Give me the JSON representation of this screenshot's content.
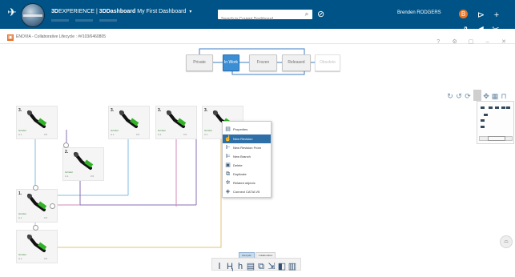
{
  "topbar": {
    "brand_bold": "3D",
    "brand_rest": "EXPERIENCE | ",
    "app_bold": "3DDashboard",
    "dashboard_name": "My First Dashboard",
    "search_placeholder": "Search in Current Dashboard",
    "user_name": "Brenden RODGERS",
    "avatar_letter": "B"
  },
  "window": {
    "title": "ENOVIA - Collaborative Lifecycle : ##103/6460805"
  },
  "lifecycle": {
    "states": [
      "Private",
      "In Work",
      "Frozen",
      "Released",
      "Obsolete"
    ]
  },
  "cards": [
    {
      "revision": "3.",
      "label": "Grinder",
      "state": "A.1"
    },
    {
      "revision": "3.",
      "label": "Grinder",
      "state": "A.1"
    },
    {
      "revision": "3.",
      "label": "Grinder",
      "state": "A.1"
    },
    {
      "revision": "3.",
      "label": "Grinder",
      "state": "A.1"
    },
    {
      "revision": "2.",
      "label": "Grinder",
      "state": "A.1"
    },
    {
      "revision": "1.",
      "label": "Grinder",
      "state": "A.1"
    },
    {
      "revision": "",
      "label": "Grinder",
      "state": "A.1"
    },
    {
      "revision": "",
      "label": "Grinder",
      "state": "A.1"
    }
  ],
  "context_menu": {
    "items": [
      {
        "label": "Properties",
        "icon": "properties-icon"
      },
      {
        "label": "New Revision",
        "icon": "new-revision-icon"
      },
      {
        "label": "New Revision From",
        "icon": "new-revision-from-icon"
      },
      {
        "label": "New Branch",
        "icon": "new-branch-icon"
      },
      {
        "label": "Delete",
        "icon": "delete-icon"
      },
      {
        "label": "Duplicate",
        "icon": "duplicate-icon"
      },
      {
        "label": "Related objects",
        "icon": "related-objects-icon"
      },
      {
        "label": "Connect CATIA V5",
        "icon": "connect-catia-icon"
      }
    ]
  },
  "bottom": {
    "tabs": [
      "Lifecycle",
      "Collaboration"
    ]
  },
  "colors": {
    "topbar": "#005386",
    "active_state": "#3b8dd4",
    "menu_highlight": "#2f6fa8",
    "link_blue": "#7fbfe0",
    "link_purple": "#8a6fb6",
    "link_pink": "#d38ab8",
    "link_orange": "#e2c27a"
  }
}
